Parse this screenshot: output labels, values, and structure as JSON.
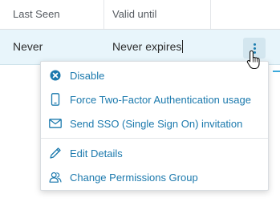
{
  "table": {
    "columns": [
      "Last Seen",
      "Valid until"
    ],
    "row": {
      "last_seen": "Never",
      "valid_until": "Never expires"
    }
  },
  "menu": {
    "items": [
      {
        "label": "Disable",
        "icon": "disable-circle-x-icon"
      },
      {
        "label": "Force Two-Factor Authentication usage",
        "icon": "mobile-phone-icon"
      },
      {
        "label": "Send SSO (Single Sign On) invitation",
        "icon": "envelope-icon"
      },
      {
        "label": "Edit Details",
        "icon": "pencil-icon"
      },
      {
        "label": "Change Permissions Group",
        "icon": "users-group-icon"
      }
    ]
  },
  "colors": {
    "accent": "#1b79ad",
    "row_selected": "#e8f5fb"
  }
}
